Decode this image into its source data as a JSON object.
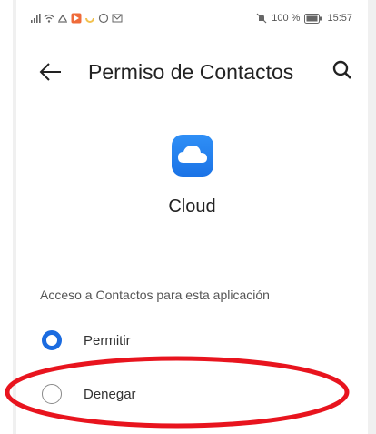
{
  "status_bar": {
    "left_icons": [
      "signal-icon",
      "wifi-icon",
      "sync-icon",
      "app-notification-icon",
      "circle-icon",
      "mail-icon"
    ],
    "mute_icon": "mute-icon",
    "battery_percent": "100 %",
    "time": "15:57"
  },
  "header": {
    "back_icon": "arrow-left-icon",
    "title": "Permiso de Contactos",
    "search_icon": "search-icon"
  },
  "app": {
    "icon": "cloud-icon",
    "name": "Cloud"
  },
  "permission": {
    "section_label": "Acceso a Contactos para esta aplicación",
    "options": [
      {
        "label": "Permitir",
        "selected": true
      },
      {
        "label": "Denegar",
        "selected": false
      }
    ]
  },
  "annotation": {
    "color": "#e8141e",
    "target": "Denegar"
  },
  "colors": {
    "accent": "#1a6be0",
    "text_primary": "#222222",
    "text_secondary": "#555555"
  }
}
